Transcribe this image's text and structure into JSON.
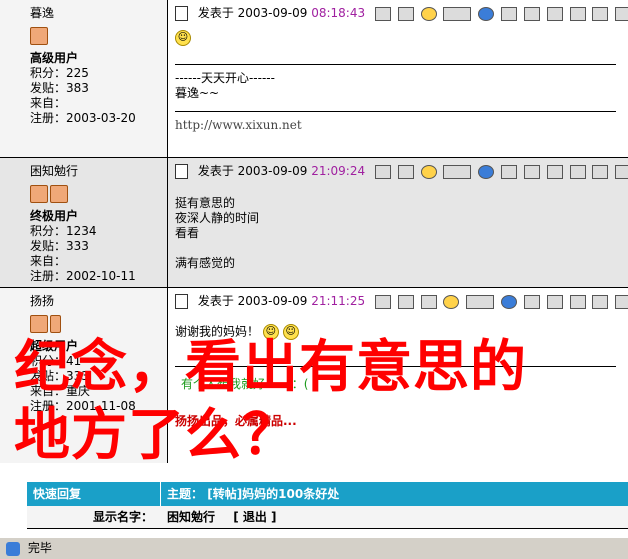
{
  "posts": [
    {
      "username": "暮逸",
      "rank": "高级用户",
      "stats": [
        "积分：225",
        "发贴：383",
        "来自：",
        "注册：2003-03-20"
      ],
      "headline_prefix": "发表于 2003-09-09",
      "time": "08:18:43",
      "content": [
        "------天天开心------",
        "暮逸~~"
      ],
      "url": "http://www.xixun.net"
    },
    {
      "username": "困知勉行",
      "rank": "终极用户",
      "stats": [
        "积分：1234",
        "发贴：333",
        "来自：",
        "注册：2002-10-11"
      ],
      "headline_prefix": "发表于 2003-09-09",
      "time": "21:09:24",
      "content": [
        "挺有意思的",
        "夜深人静的时间",
        "看看",
        "满有感觉的"
      ]
    },
    {
      "username": "扬扬",
      "rank": "超级用户",
      "stats": [
        "积分：41",
        "发贴：333",
        "来自：重庆",
        "注册：2001-11-08"
      ],
      "headline_prefix": "发表于 2003-09-09",
      "time": "21:11:25",
      "content": [
        "谢谢我的妈妈！"
      ],
      "sig1": "有个人想我就好 ......：(",
      "sig2": "扬扬出品，必属精品..."
    }
  ],
  "quick_reply": {
    "title": "快速回复",
    "subject_label": "主题：",
    "subject": "[转帖]妈妈的100条好处",
    "name_label": "显示名字：",
    "name": "困知勉行",
    "logout": "[ 退出 ]"
  },
  "status": {
    "text": "完毕"
  },
  "overlay": {
    "line1": "纪念，看出有意思的",
    "line2": "地方了么？"
  },
  "colors": {
    "time": "#a020a0",
    "quick_header": "#1aa0c8",
    "overlay": "#ff0000"
  }
}
